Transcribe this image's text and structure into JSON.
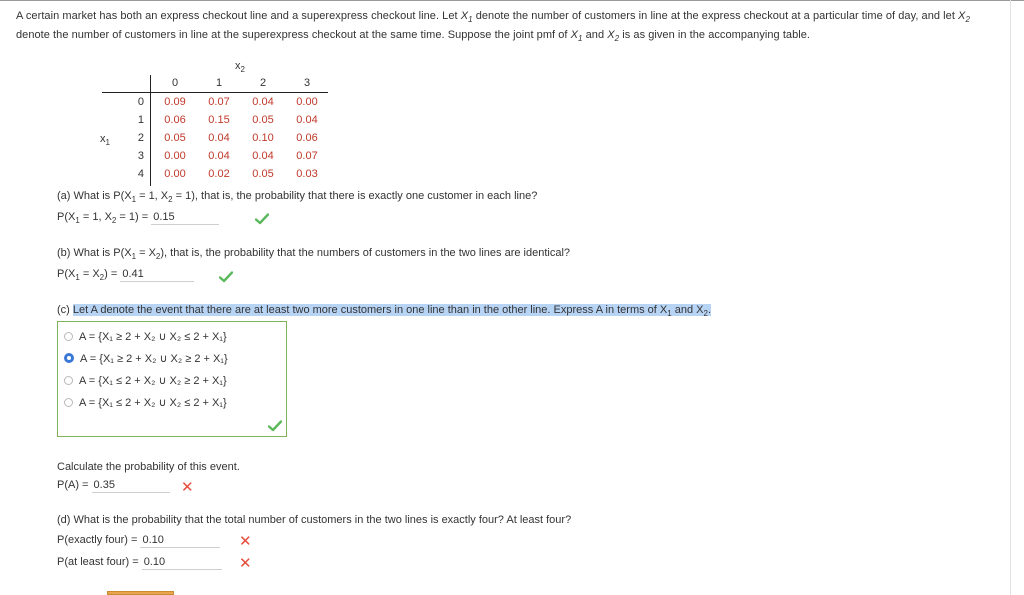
{
  "intro": {
    "p1": "A certain market has both an express checkout line and a superexpress checkout line. Let ",
    "p2": " denote the number of customers in line at the express checkout at a particular time of day, and let ",
    "p3": " denote the number of customers in line at the superexpress checkout at the same time. Suppose the joint pmf of ",
    "p4": " and ",
    "p5": " is as given in the accompanying table."
  },
  "table": {
    "x2_label": "x",
    "x1_label": "x",
    "col_headers": [
      "0",
      "1",
      "2",
      "3"
    ],
    "row_headers": [
      "0",
      "1",
      "2",
      "3",
      "4"
    ],
    "cells": [
      [
        "0.09",
        "0.07",
        "0.04",
        "0.00"
      ],
      [
        "0.06",
        "0.15",
        "0.05",
        "0.04"
      ],
      [
        "0.05",
        "0.04",
        "0.10",
        "0.06"
      ],
      [
        "0.00",
        "0.04",
        "0.04",
        "0.07"
      ],
      [
        "0.00",
        "0.02",
        "0.05",
        "0.03"
      ]
    ]
  },
  "qa": {
    "question": "(a) What is P(X",
    "question_rest": " = 1, X",
    "question_end": " = 1), that is, the probability that there is exactly one customer in each line?",
    "label": "P(X",
    "label_mid": " = 1, X",
    "label_end": " = 1) = ",
    "answer": "0.15"
  },
  "qb": {
    "question": "(b) What is P(X",
    "question_rest": " = X",
    "question_end": "), that is, the probability that the numbers of customers in the two lines are identical?",
    "label": "P(X",
    "label_mid": " = X",
    "label_end": ") = ",
    "answer": "0.41"
  },
  "qc": {
    "prefix": "(c) ",
    "question": "Let A denote the event that there are at least two more customers in one line than in the other line. Express A in terms of X",
    "question_and": " and X",
    "question_end": ".",
    "options": [
      "A = {X₁ ≥ 2 + X₂ ∪ X₂ ≤ 2 + X₁}",
      "A = {X₁ ≥ 2 + X₂ ∪ X₂ ≥ 2 + X₁}",
      "A = {X₁ ≤ 2 + X₂ ∪ X₂ ≥ 2 + X₁}",
      "A = {X₁ ≤ 2 + X₂ ∪ X₂ ≤ 2 + X₁}"
    ],
    "calc_text": "Calculate the probability of this event.",
    "pa_label": "P(A) = ",
    "pa_answer": "0.35"
  },
  "qd": {
    "question": "(d) What is the probability that the total number of customers in the two lines is exactly four? At least four?",
    "exact_label": "P(exactly four) = ",
    "exact_answer": "0.10",
    "atleast_label": "P(at least four) = ",
    "atleast_answer": "0.10"
  },
  "colors": {
    "table_values": "#c0392b",
    "check": "#5cb85c",
    "cross": "#e74c3c",
    "selected_radio": "#3a78d8",
    "highlight": "#b8d4f5",
    "choice_border": "#7fb35a"
  }
}
